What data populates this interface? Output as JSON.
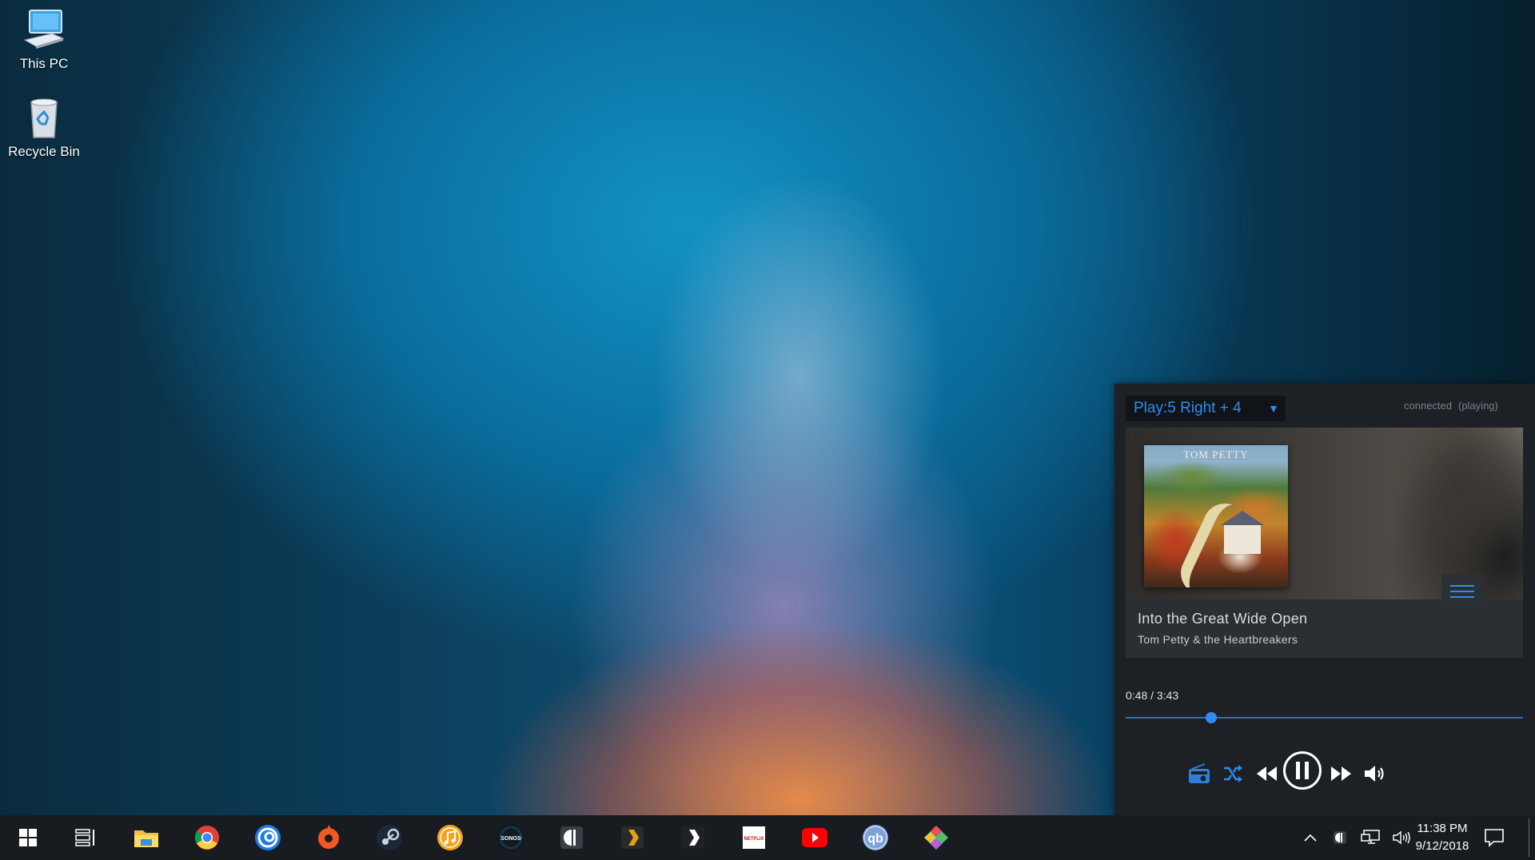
{
  "desktop": {
    "icons": [
      {
        "label": "This PC",
        "icon": "this-pc-icon"
      },
      {
        "label": "Recycle Bin",
        "icon": "recycle-bin-icon"
      }
    ]
  },
  "player": {
    "zone": "Play:5 Right + 4",
    "status_connection": "connected",
    "status_state": "(playing)",
    "track_title": "Into the Great Wide Open",
    "track_artist": "Tom Petty & the Heartbreakers",
    "album_art_text": "TOM PETTY",
    "elapsed": "0:48",
    "separator": "/",
    "duration": "3:43",
    "progress_fraction": 0.215,
    "accent_color": "#2f8cf0",
    "controls": [
      "radio-icon",
      "shuffle-icon",
      "rewind-icon",
      "pause-icon",
      "fast-forward-icon",
      "volume-icon"
    ]
  },
  "taskbar": {
    "apps": [
      "windows-start-icon",
      "task-view-icon",
      "file-explorer-icon",
      "chrome-icon",
      "uplay-icon",
      "origin-icon",
      "steam-icon",
      "itunes-icon",
      "sonos-icon",
      "audio-app-icon",
      "plex-icon",
      "plex-media-player-icon",
      "netflix-icon",
      "youtube-icon",
      "qbittorrent-icon",
      "kodi-icon"
    ],
    "sonos_label": "SONOS",
    "netflix_label": "NETFLIX",
    "qb_label": "qb",
    "time": "11:38 PM",
    "date": "9/12/2018"
  }
}
